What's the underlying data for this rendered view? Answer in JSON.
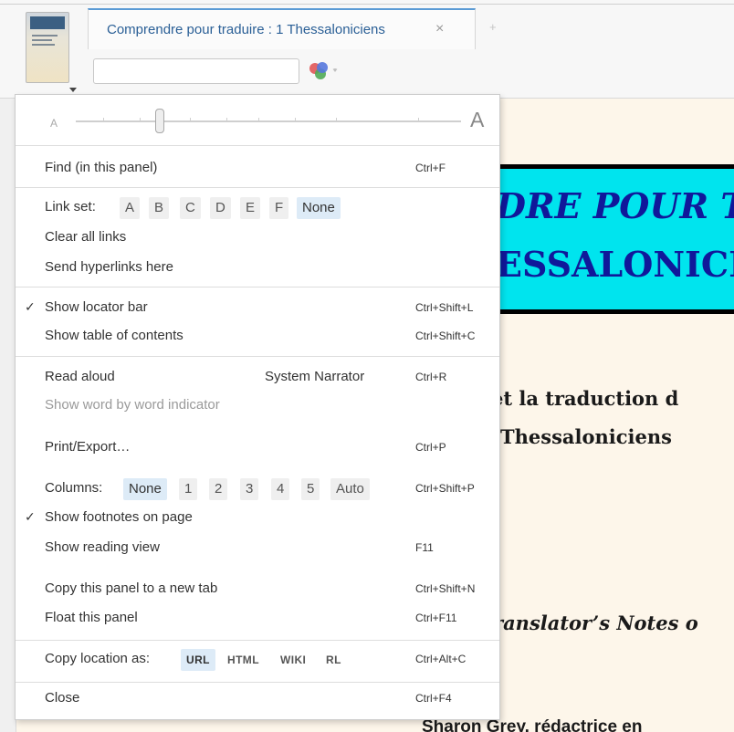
{
  "tab": {
    "title": "Comprendre pour traduire : 1 Thessaloniciens",
    "close_icon": "close-icon",
    "add_icon": "plus-icon"
  },
  "search": {
    "value": "",
    "placeholder": ""
  },
  "document": {
    "banner_line1": "DRE POUR T",
    "banner_line2": "ESSALONICI",
    "line1": "et la traduction d",
    "line2": "Thessaloniciens",
    "line3": "ranslator’s Notes o",
    "line4": "Sharon Grey, rédactrice en"
  },
  "menu": {
    "font_size": {
      "small_label": "A",
      "large_label": "A"
    },
    "find": {
      "label": "Find (in this panel)",
      "shortcut": "Ctrl+F"
    },
    "link_set": {
      "label": "Link set:",
      "options": [
        "A",
        "B",
        "C",
        "D",
        "E",
        "F",
        "None"
      ],
      "selected": "None"
    },
    "clear_links": {
      "label": "Clear all links"
    },
    "send_hyperlinks": {
      "label": "Send hyperlinks here"
    },
    "locator_bar": {
      "label": "Show locator bar",
      "shortcut": "Ctrl+Shift+L",
      "check": "✓"
    },
    "toc": {
      "label": "Show table of contents",
      "shortcut": "Ctrl+Shift+C"
    },
    "read_aloud": {
      "label": "Read aloud",
      "voice": "System Narrator",
      "shortcut": "Ctrl+R"
    },
    "word_indicator": {
      "label": "Show word by word indicator"
    },
    "print": {
      "label": "Print/Export…",
      "shortcut": "Ctrl+P"
    },
    "columns": {
      "label": "Columns:",
      "options": [
        "None",
        "1",
        "2",
        "3",
        "4",
        "5",
        "Auto"
      ],
      "selected": "None",
      "shortcut": "Ctrl+Shift+P"
    },
    "footnotes": {
      "label": "Show footnotes on page",
      "check": "✓"
    },
    "reading_view": {
      "label": "Show reading view",
      "shortcut": "F11"
    },
    "copy_panel": {
      "label": "Copy this panel to a new tab",
      "shortcut": "Ctrl+Shift+N"
    },
    "float_panel": {
      "label": "Float this panel",
      "shortcut": "Ctrl+F11"
    },
    "copy_location": {
      "label": "Copy location as:",
      "options": [
        "URL",
        "HTML",
        "WIKI",
        "RL"
      ],
      "selected": "URL",
      "shortcut": "Ctrl+Alt+C"
    },
    "close": {
      "label": "Close",
      "shortcut": "Ctrl+F4"
    }
  },
  "colors": {
    "accent": "#5b9bd5",
    "tab_title": "#2a5f96",
    "selected_option": "#ddebf7",
    "banner": "#00e4ee"
  }
}
